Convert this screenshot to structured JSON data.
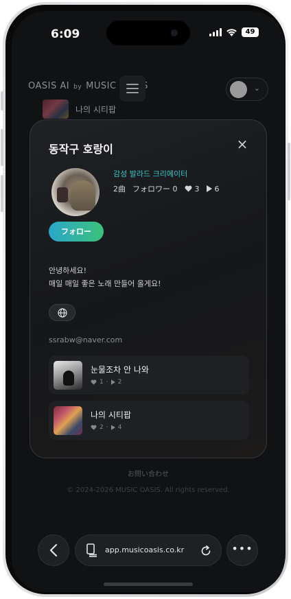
{
  "status_bar": {
    "time": "6:09",
    "battery": "49"
  },
  "header": {
    "logo": "OASIS AI",
    "by": "by",
    "logo_partner": "MUSIC OASIS"
  },
  "background_item": {
    "title": "나의 시티팝"
  },
  "profile": {
    "name": "동작구 호랑이",
    "creator_tag": "감성 발라드 크리에이터",
    "songs_count": "2曲",
    "followers": "フォロワー 0",
    "likes": "3",
    "plays": "6",
    "follow_label": "フォロー",
    "bio_line1": "안녕하세요!",
    "bio_line2": "매일 매일 좋은 노래 만들어 올게요!",
    "email": "ssrabw@naver.com"
  },
  "songs": [
    {
      "title": "눈물조차 안 나와",
      "likes": "1",
      "plays": "2"
    },
    {
      "title": "나의 시티팝",
      "likes": "2",
      "plays": "4"
    }
  ],
  "footer": {
    "contact": "お問い合わせ",
    "copyright": "© 2024-2026 MUSIC OASIS. All rights reserved."
  },
  "browser": {
    "url": "app.musicoasis.co.kr"
  },
  "colors": {
    "accent": "#35c6c0",
    "follow_start": "#2aa7c9",
    "follow_end": "#3cc17a"
  }
}
